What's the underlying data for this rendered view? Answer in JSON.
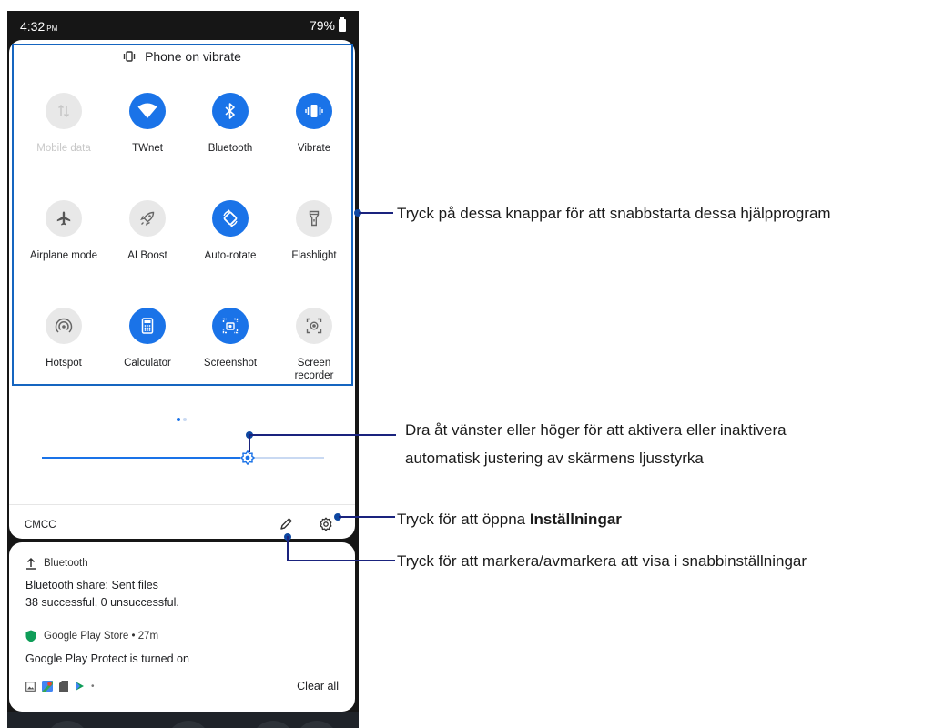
{
  "status_bar": {
    "time": "4:32",
    "ampm": "PM",
    "battery": "79%"
  },
  "quick_settings": {
    "header": "Phone on vibrate",
    "tiles": [
      {
        "id": "mobile-data",
        "label": "Mobile data",
        "state": "disabled",
        "icon": "mobile-data-icon"
      },
      {
        "id": "wifi",
        "label": "TWnet",
        "state": "on",
        "icon": "wifi-icon"
      },
      {
        "id": "bluetooth",
        "label": "Bluetooth",
        "state": "on",
        "icon": "bluetooth-icon"
      },
      {
        "id": "vibrate",
        "label": "Vibrate",
        "state": "on",
        "icon": "vibrate-icon"
      },
      {
        "id": "airplane",
        "label": "Airplane mode",
        "state": "off",
        "icon": "airplane-icon"
      },
      {
        "id": "ai-boost",
        "label": "AI Boost",
        "state": "off",
        "icon": "rocket-icon"
      },
      {
        "id": "auto-rotate",
        "label": "Auto-rotate",
        "state": "on",
        "icon": "rotate-icon"
      },
      {
        "id": "flashlight",
        "label": "Flashlight",
        "state": "off",
        "icon": "flashlight-icon"
      },
      {
        "id": "hotspot",
        "label": "Hotspot",
        "state": "off",
        "icon": "hotspot-icon"
      },
      {
        "id": "calculator",
        "label": "Calculator",
        "state": "on",
        "icon": "calculator-icon"
      },
      {
        "id": "screenshot",
        "label": "Screenshot",
        "state": "on",
        "icon": "screenshot-icon"
      },
      {
        "id": "screen-recorder",
        "label": "Screen\nrecorder",
        "state": "off",
        "icon": "screen-recorder-icon"
      }
    ],
    "brightness_level": 0.73,
    "carrier": "CMCC"
  },
  "notifications": [
    {
      "app": "Bluetooth",
      "title": "Bluetooth share: Sent files",
      "body": "38 successful, 0 unsuccessful."
    },
    {
      "app": "Google Play Store • 27m",
      "title": "Google Play Protect is turned on"
    }
  ],
  "clear_all": "Clear all",
  "callouts": {
    "tiles": "Tryck på dessa knappar för att snabbstarta dessa hjälpprogram",
    "brightness_line1": "Dra åt vänster eller höger för att aktivera eller inaktivera",
    "brightness_line2": "automatisk justering av skärmens ljusstyrka",
    "settings_prefix": "Tryck för att öppna ",
    "settings_bold": "Inställningar",
    "edit": "Tryck för att markera/avmarkera att visa i snabbinställningar"
  },
  "colors": {
    "accent": "#1a73e8",
    "callout_line": "#1a237e",
    "highlight_box": "#1565c0"
  }
}
